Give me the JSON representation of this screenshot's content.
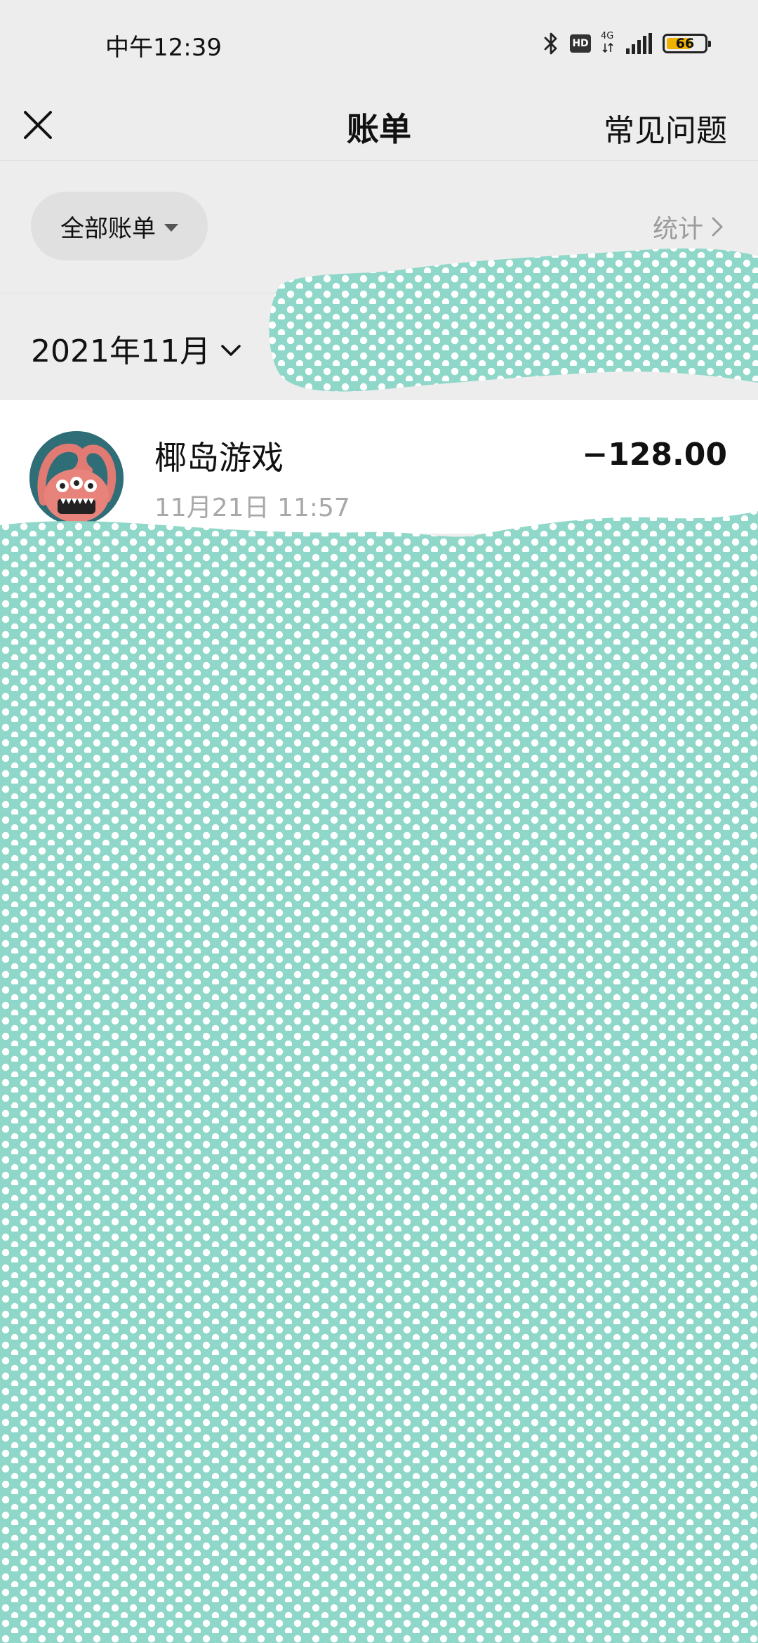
{
  "status_bar": {
    "time": "中午12:39",
    "network": "4G",
    "battery": "66",
    "battery_level_percent": 66,
    "icons": [
      "bluetooth-icon",
      "hd-icon",
      "signal-icon",
      "battery-icon"
    ]
  },
  "nav": {
    "title": "账单",
    "faq_label": "常见问题",
    "close_icon": "close-icon"
  },
  "filter": {
    "all_bills_label": "全部账单",
    "stats_label": "统计"
  },
  "month": {
    "label": "2021年11月"
  },
  "transactions": [
    {
      "name": "椰岛游戏",
      "time": "11月21日 11:57",
      "amount": "−128.00"
    }
  ],
  "colors": {
    "background": "#ededed",
    "redaction_fill": "#8fd7c8",
    "redaction_dot": "#ffffff",
    "battery_fill": "#f0b400"
  }
}
